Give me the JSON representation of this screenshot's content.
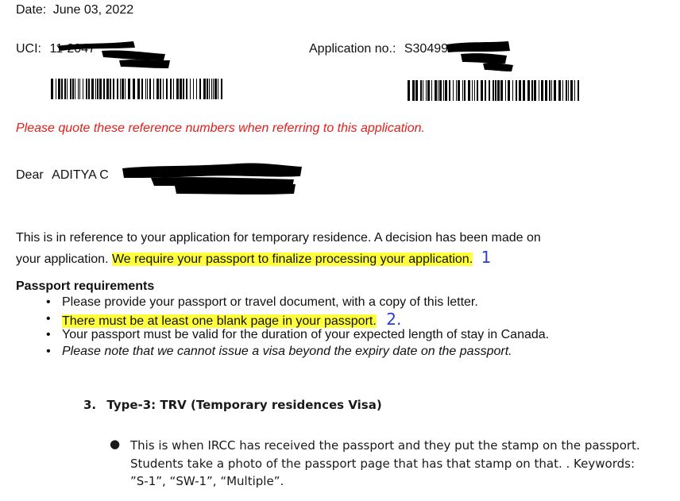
{
  "letter": {
    "date_label": "Date:",
    "date_value": "June 03, 2022",
    "uci_label": "UCI:",
    "uci_value": "11-2047",
    "app_label": "Application no.:",
    "app_value": "S30499",
    "reference_note": "Please quote these reference numbers when referring to this application.",
    "dear_label": "Dear",
    "dear_name": "ADITYA C",
    "para_line1": "This is in reference to your application for temporary residence. A decision has been made on",
    "para_line2_a": "your application.",
    "para_line2_highlight": "We require your passport to finalize processing your application.",
    "para_annotation": "1",
    "section_title": "Passport requirements",
    "requirements": [
      "Please provide your passport or travel document, with a copy of this letter.",
      "There must be at least one blank page in your passport.",
      "Your passport must be valid for the duration of your expected length of stay in Canada.",
      "Please note that we cannot issue a visa beyond the expiry date on the passport."
    ],
    "req_annotation": "2."
  },
  "notes": {
    "heading_number": "3.",
    "heading_text": "Type-3: TRV (Temporary residences Visa)",
    "bullet_line1": "This is when IRCC has received the passport and they put the stamp on the passport.",
    "bullet_line2": "Students take a photo of the passport page that has that stamp on that. . Keywords:",
    "bullet_line3": "”S-1”,  “SW-1”, “Multiple”."
  },
  "colors": {
    "highlight": "#ffff3c",
    "reference_red": "#e0201b",
    "annotation_blue": "#2a3cd6"
  }
}
